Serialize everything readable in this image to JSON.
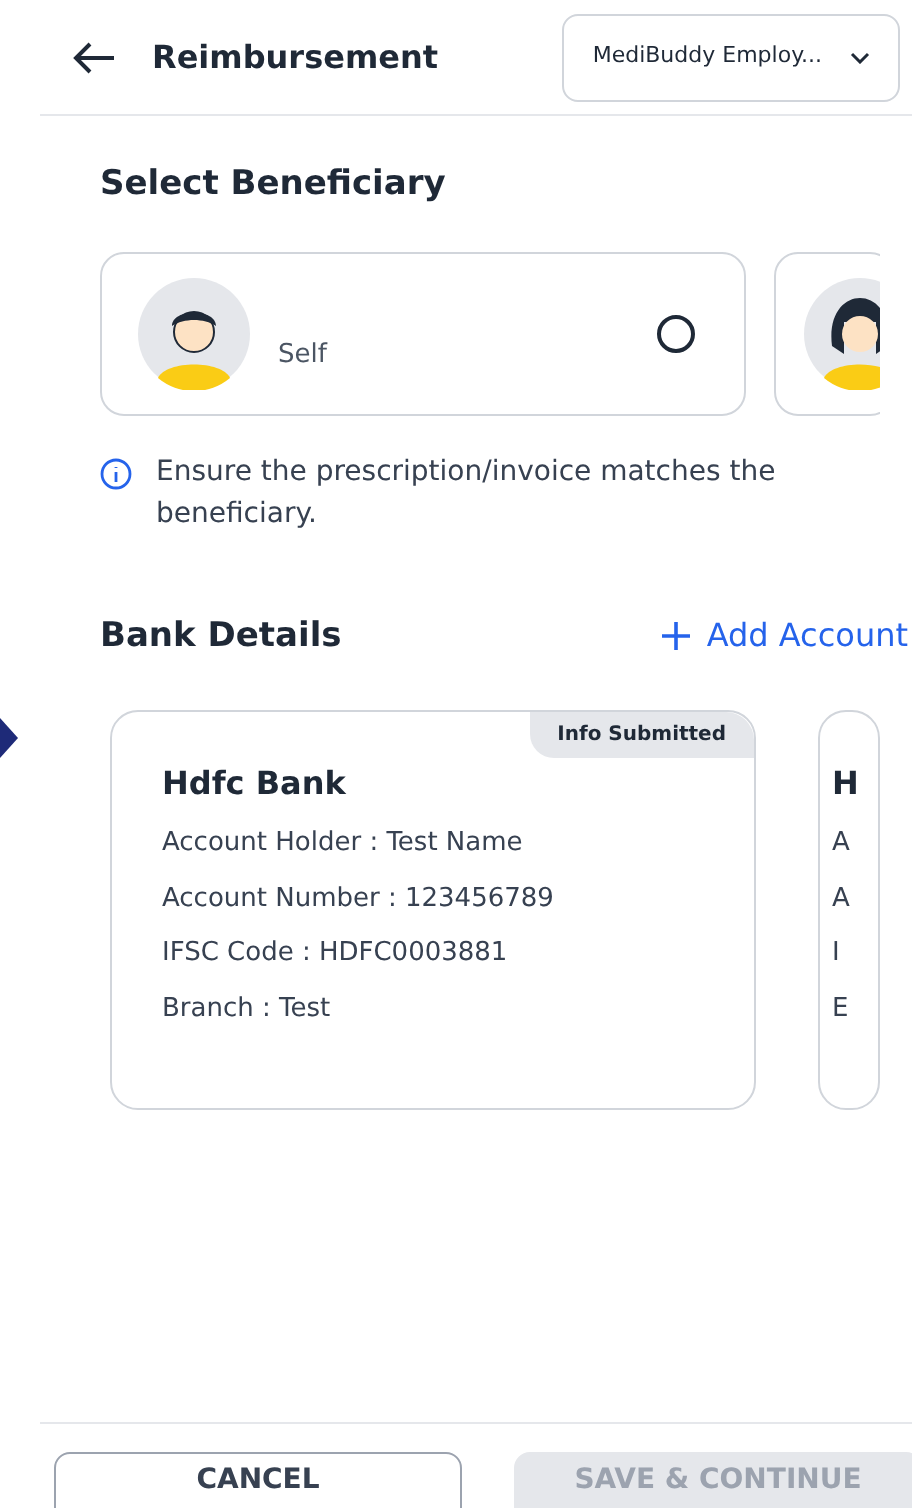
{
  "header": {
    "title": "Reimbursement",
    "dropdown": "MediBuddy Employ..."
  },
  "beneficiary_section": {
    "title": "Select Beneficiary",
    "items": [
      {
        "label": "Self",
        "selected": false,
        "kind": "male"
      },
      {
        "selected": false,
        "kind": "female"
      }
    ]
  },
  "notice": "Ensure the prescription/invoice matches the beneficiary.",
  "bank_section": {
    "title": "Bank Details",
    "add_action": "Add Account",
    "accounts": [
      {
        "badge": "Info Submitted",
        "bank": "Hdfc Bank",
        "lines": [
          "Account Holder : Test Name",
          "Account Number : 123456789",
          "IFSC Code : HDFC0003881",
          "Branch : Test"
        ]
      },
      {
        "bank": "H",
        "lines": [
          "A",
          "A",
          "I",
          "E"
        ]
      }
    ]
  },
  "footer": {
    "buttons": [
      {
        "label": "CANCEL",
        "disabled": false
      },
      {
        "label": "SAVE & CONTINUE",
        "disabled": true
      }
    ]
  }
}
